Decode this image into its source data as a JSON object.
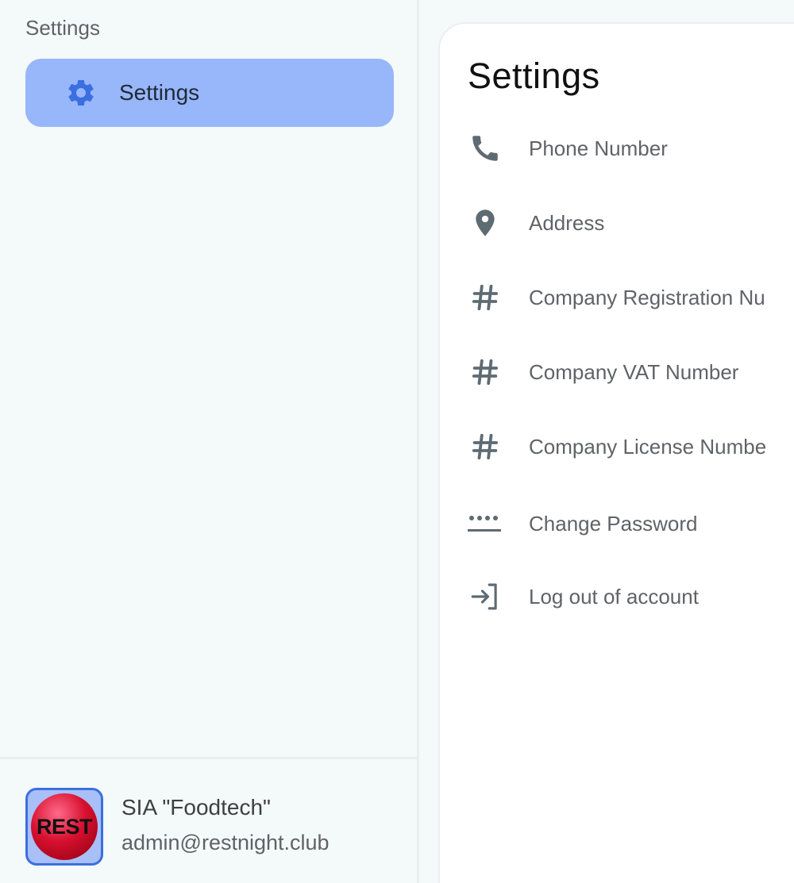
{
  "sidebar": {
    "heading": "Settings",
    "nav": [
      {
        "label": "Settings",
        "icon": "gear-icon",
        "active": true
      }
    ],
    "footer": {
      "avatar_text": "REST",
      "org_name": "SIA \"Foodtech\"",
      "email": "admin@restnight.club"
    }
  },
  "main": {
    "title": "Settings",
    "rows": [
      {
        "label": "Phone Number",
        "icon": "phone-icon"
      },
      {
        "label": "Address",
        "icon": "location-pin-icon"
      },
      {
        "label": "Company Registration Nu",
        "icon": "hash-icon"
      },
      {
        "label": "Company VAT Number",
        "icon": "hash-icon"
      },
      {
        "label": "Company License Numbe",
        "icon": "hash-icon"
      },
      {
        "label": "Change Password",
        "icon": "password-icon"
      },
      {
        "label": "Log out of account",
        "icon": "logout-icon"
      }
    ]
  },
  "colors": {
    "active_nav": "#98b6fa",
    "accent": "#3b6fe0",
    "icon": "#5f6b73"
  }
}
